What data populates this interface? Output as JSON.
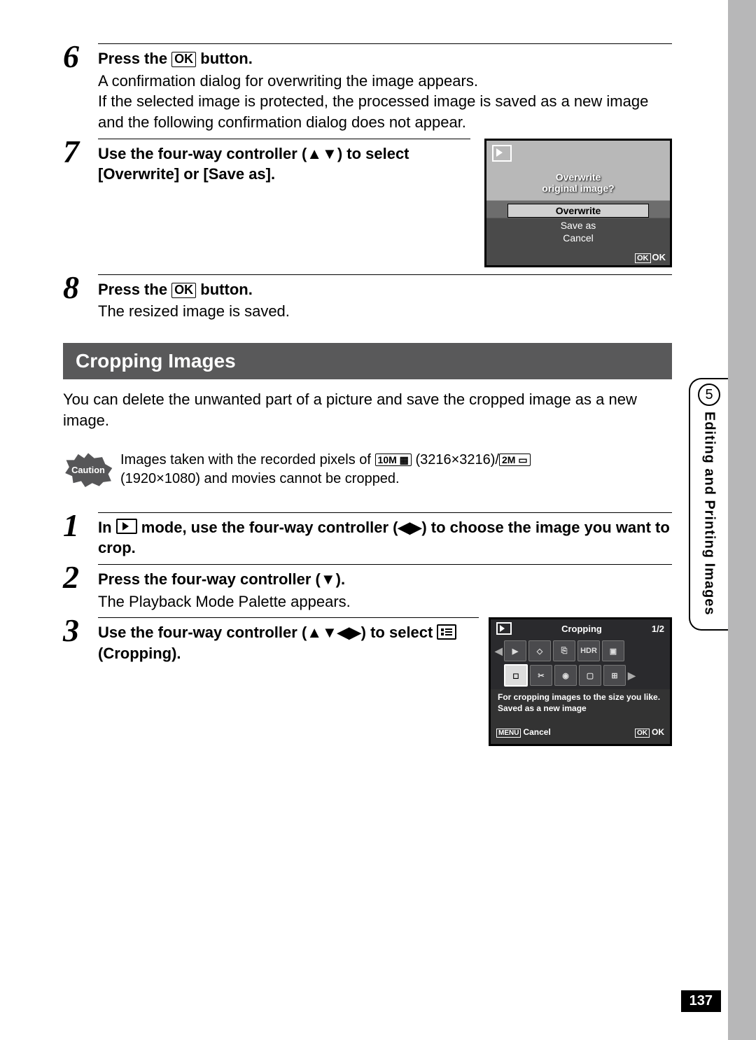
{
  "sidebar": {
    "chapter": "5",
    "title": "Editing and Printing Images"
  },
  "page_number": "137",
  "steps_a": [
    {
      "n": "6",
      "title_pre": "Press the ",
      "ok": "OK",
      "title_post": " button.",
      "desc": "A confirmation dialog for overwriting the image appears.\nIf the selected image is protected, the processed image is saved as a new image and the following confirmation dialog does not appear."
    },
    {
      "n": "7",
      "title": "Use the four-way controller (▲▼) to select [Overwrite] or [Save as]."
    },
    {
      "n": "8",
      "title_pre": "Press the ",
      "ok": "OK",
      "title_post": " button.",
      "desc": "The resized image is saved."
    }
  ],
  "screen1": {
    "prompt_l1": "Overwrite",
    "prompt_l2": "original image?",
    "opt1": "Overwrite",
    "opt2": "Save as",
    "opt3": "Cancel",
    "ok_badge": "OK",
    "ok_txt": "OK"
  },
  "heading": "Cropping Images",
  "intro": "You can delete the unwanted part of a picture and save the cropped image as a new image.",
  "caution": {
    "label": "Caution",
    "text_pre": "Images taken with the recorded pixels of ",
    "badge1": "10M",
    "res1": " (3216×3216)/",
    "badge2": "2M",
    "res2": "\n(1920×1080) and movies cannot be cropped."
  },
  "steps_b": [
    {
      "n": "1",
      "title_pre": "In ",
      "title_post": " mode, use the four-way controller (◀▶) to choose the image you want to crop."
    },
    {
      "n": "2",
      "title": "Press the four-way controller (▼).",
      "desc": "The Playback Mode Palette appears."
    },
    {
      "n": "3",
      "title_pre": "Use the four-way controller (▲▼◀▶) to select ",
      "title_post": " (Cropping)."
    }
  ],
  "screen2": {
    "title": "Cropping",
    "page": "1/2",
    "icons_r1": [
      "▶",
      "◇",
      "⎘",
      "HDR",
      "▣"
    ],
    "icons_r2": [
      "◻",
      "✂",
      "◉",
      "▢",
      "⊞"
    ],
    "desc": "For cropping images to the size you like. Saved as a new image",
    "menu_badge": "MENU",
    "menu_txt": "Cancel",
    "ok_badge": "OK",
    "ok_txt": "OK"
  }
}
